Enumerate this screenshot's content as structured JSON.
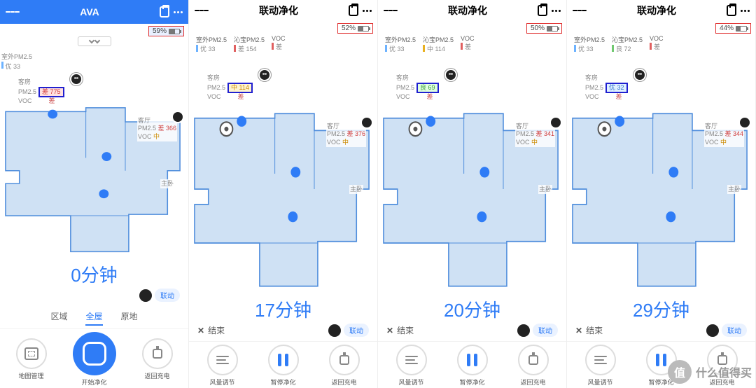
{
  "panes": [
    {
      "title": "AVA",
      "blueHeader": true,
      "battery": {
        "pct": "59%",
        "fill": 59
      },
      "showPull": true,
      "stats": null,
      "outdoorLine": {
        "label": "室外PM2.5",
        "value": "优 33",
        "color": "#6cb2ff"
      },
      "room1": {
        "name": "客房",
        "pm25_label": "PM2.5",
        "pm25_level": "差",
        "pm25_val": "775",
        "voc_label": "VOC",
        "voc_val": "差"
      },
      "room2": {
        "name": "客厅",
        "pm25_label": "PM2.5",
        "pm25_level": "差",
        "pm25_val": "366",
        "voc_label": "VOC",
        "voc_val": "中"
      },
      "side_room_label": "主卧",
      "robotMark": "dot",
      "timer": "0分钟",
      "tabs": [
        "区域",
        "全屋",
        "原地"
      ],
      "activeTab": "全屋",
      "link_label": "联动",
      "buttons": [
        {
          "icon": "map",
          "label": "地图管理"
        },
        {
          "icon": "big",
          "label": "开始净化"
        },
        {
          "icon": "plug",
          "label": "返回充电"
        }
      ]
    },
    {
      "title": "联动净化",
      "battery": {
        "pct": "52%",
        "fill": 52
      },
      "stats": [
        {
          "h": "室外PM2.5",
          "v": "优 33",
          "c": "#6cb2ff"
        },
        {
          "h": "沁宝PM2.5",
          "v": "差 154",
          "c": "#e06060"
        },
        {
          "h": "VOC",
          "v": "差",
          "c": "#e06060"
        }
      ],
      "room1": {
        "name": "客房",
        "pm25_label": "PM2.5",
        "pm25_level": "中",
        "pm25_val": "114",
        "voc_label": "VOC",
        "voc_val": "差"
      },
      "room2": {
        "name": "客厅",
        "pm25_label": "PM2.5",
        "pm25_level": "差",
        "pm25_val": "376",
        "voc_label": "VOC",
        "voc_val": "中"
      },
      "side_room_label": "主卧",
      "robotMark": "ring",
      "timer": "17分钟",
      "end_label": "结束",
      "link_label": "联动",
      "buttons": [
        {
          "icon": "wind",
          "label": "风量调节"
        },
        {
          "icon": "pause",
          "label": "暂停净化"
        },
        {
          "icon": "plug",
          "label": "返回充电"
        }
      ]
    },
    {
      "title": "联动净化",
      "battery": {
        "pct": "50%",
        "fill": 50
      },
      "stats": [
        {
          "h": "室外PM2.5",
          "v": "优 33",
          "c": "#6cb2ff"
        },
        {
          "h": "沁宝PM2.5",
          "v": "中 114",
          "c": "#e8b020"
        },
        {
          "h": "VOC",
          "v": "差",
          "c": "#e06060"
        }
      ],
      "room1": {
        "name": "客房",
        "pm25_label": "PM2.5",
        "pm25_level": "良",
        "pm25_val": "69",
        "voc_label": "VOC",
        "voc_val": "差"
      },
      "room2": {
        "name": "客厅",
        "pm25_label": "PM2.5",
        "pm25_level": "差",
        "pm25_val": "341",
        "voc_label": "VOC",
        "voc_val": "中"
      },
      "side_room_label": "主卧",
      "robotMark": "ring",
      "timer": "20分钟",
      "end_label": "结束",
      "link_label": "联动",
      "buttons": [
        {
          "icon": "wind",
          "label": "风量调节"
        },
        {
          "icon": "pause",
          "label": "暂停净化"
        },
        {
          "icon": "plug",
          "label": "返回充电"
        }
      ]
    },
    {
      "title": "联动净化",
      "battery": {
        "pct": "44%",
        "fill": 44
      },
      "stats": [
        {
          "h": "室外PM2.5",
          "v": "优 33",
          "c": "#6cb2ff"
        },
        {
          "h": "沁宝PM2.5",
          "v": "良 72",
          "c": "#70c870"
        },
        {
          "h": "VOC",
          "v": "差",
          "c": "#e06060"
        }
      ],
      "room1": {
        "name": "客房",
        "pm25_label": "PM2.5",
        "pm25_level": "优",
        "pm25_val": "32",
        "voc_label": "VOC",
        "voc_val": "差"
      },
      "room2": {
        "name": "客厅",
        "pm25_label": "PM2.5",
        "pm25_level": "差",
        "pm25_val": "344",
        "voc_label": "VOC",
        "voc_val": "中"
      },
      "side_room_label": "主卧",
      "robotMark": "ring",
      "timer": "29分钟",
      "end_label": "结束",
      "link_label": "联动",
      "buttons": [
        {
          "icon": "wind",
          "label": "风量调节"
        },
        {
          "icon": "pause",
          "label": "暂停净化"
        },
        {
          "icon": "plug",
          "label": "返回充电"
        }
      ]
    }
  ],
  "watermark": "什么值得买"
}
